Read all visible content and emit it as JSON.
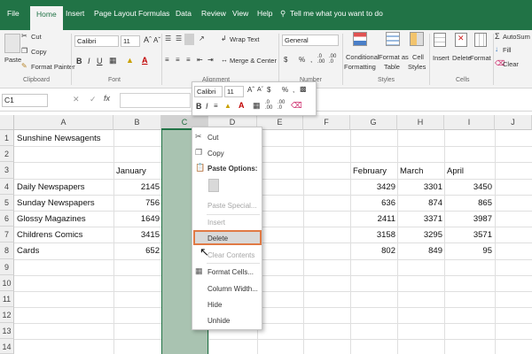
{
  "tabs": [
    "File",
    "Home",
    "Insert",
    "Page Layout",
    "Formulas",
    "Data",
    "Review",
    "View",
    "Help"
  ],
  "tell_me": "Tell me what you want to do",
  "ribbon": {
    "paste": "Paste",
    "cut": "Cut",
    "copy": "Copy",
    "format_painter": "Format Painter",
    "clipboard": "Clipboard",
    "font_name": "Calibri",
    "font_size": "11",
    "font_group": "Font",
    "wrap_text": "Wrap Text",
    "merge_center": "Merge & Center",
    "alignment": "Alignment",
    "number_format": "General",
    "number_group": "Number",
    "conditional_formatting_1": "Conditional",
    "conditional_formatting_2": "Formatting",
    "format_as_table_1": "Format as",
    "format_as_table_2": "Table",
    "cell_styles_1": "Cell",
    "cell_styles_2": "Styles",
    "styles_group": "Styles",
    "insert": "Insert",
    "delete": "Delete",
    "format": "Format",
    "cells_group": "Cells",
    "autosum": "AutoSum",
    "fill": "Fill",
    "clear": "Clear",
    "currency_symbol": "$",
    "percent_symbol": "%",
    "comma_symbol": ",",
    "font_color_letter": "A",
    "fill_color_letter": "A"
  },
  "formula_bar": {
    "name_box": "C1",
    "fx": "fx"
  },
  "columns": [
    "A",
    "B",
    "C",
    "D",
    "E",
    "F",
    "G",
    "H",
    "I",
    "J"
  ],
  "rows": [
    "1",
    "2",
    "3",
    "4",
    "5",
    "6",
    "7",
    "8",
    "9",
    "10",
    "11",
    "12",
    "13",
    "14"
  ],
  "sheet": {
    "title": "Sunshine Newsagents",
    "hdr_january": "January",
    "hdr_february": "February",
    "hdr_march": "March",
    "hdr_april": "April",
    "items": [
      {
        "name": "Daily Newspapers",
        "jan": "2145",
        "feb": "3429",
        "mar": "3301",
        "apr": "3450"
      },
      {
        "name": "Sunday Newspapers",
        "jan": "756",
        "feb": "636",
        "mar": "874",
        "apr": "865"
      },
      {
        "name": "Glossy Magazines",
        "jan": "1649",
        "feb": "2411",
        "mar": "3371",
        "apr": "3987"
      },
      {
        "name": "Childrens Comics",
        "jan": "3415",
        "feb": "3158",
        "mar": "3295",
        "apr": "3571"
      },
      {
        "name": "Cards",
        "jan": "652",
        "feb": "802",
        "mar": "849",
        "apr": "95"
      }
    ]
  },
  "mini_toolbar": {
    "font": "Calibri",
    "size": "11",
    "bold": "B",
    "italic": "I"
  },
  "context_menu": {
    "cut": "Cut",
    "copy": "Copy",
    "paste_options": "Paste Options:",
    "paste_special": "Paste Special...",
    "insert": "Insert",
    "delete": "Delete",
    "clear_contents": "Clear Contents",
    "format_cells": "Format Cells...",
    "column_width": "Column Width...",
    "hide": "Hide",
    "unhide": "Unhide"
  },
  "colors": {
    "excel_green": "#217346",
    "selected_column": "#a9c3b1",
    "highlight_border": "#e07a45"
  }
}
